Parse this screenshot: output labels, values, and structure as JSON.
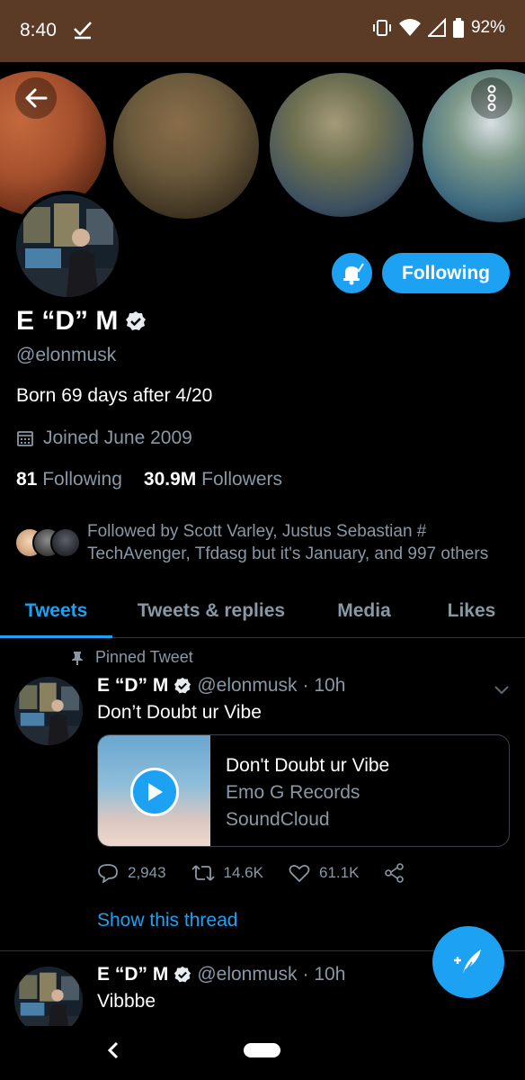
{
  "status_bar": {
    "time": "8:40",
    "battery": "92%",
    "icons": [
      "check-icon",
      "vibrate-icon",
      "wifi-icon",
      "signal-icon",
      "battery-icon"
    ]
  },
  "header": {
    "back_icon": "arrow-left-icon",
    "menu_icon": "more-vertical-icon"
  },
  "profile": {
    "name": "E “D” M",
    "verified": true,
    "handle": "@elonmusk",
    "bio": "Born 69 days after 4/20",
    "joined": "Joined June 2009",
    "following_count": "81",
    "following_label": "Following",
    "followers_count": "30.9M",
    "followers_label": "Followers",
    "follow_button": "Following",
    "followed_by": "Followed by Scott Varley, Justus Sebastian # TechAvenger, Tfdasg but it's January, and 997 others"
  },
  "tabs": [
    {
      "label": "Tweets",
      "active": true
    },
    {
      "label": "Tweets & replies",
      "active": false
    },
    {
      "label": "Media",
      "active": false
    },
    {
      "label": "Likes",
      "active": false
    }
  ],
  "tweets": [
    {
      "pinned_label": "Pinned Tweet",
      "name": "E “D” M",
      "handle": "@elonmusk",
      "time": "· 10h",
      "text": "Don’t Doubt ur Vibe",
      "card": {
        "title": "Don't Doubt ur Vibe",
        "subtitle": "Emo G Records",
        "source": "SoundCloud"
      },
      "replies": "2,943",
      "retweets": "14.6K",
      "likes": "61.1K",
      "show_thread": "Show this thread"
    },
    {
      "name": "E “D” M",
      "handle": "@elonmusk",
      "time": "· 10h",
      "text": "Vibbbe"
    }
  ],
  "colors": {
    "accent": "#1da1f2",
    "background": "#000000",
    "status_bar": "#5b3a26",
    "secondary_text": "#8899a6"
  }
}
